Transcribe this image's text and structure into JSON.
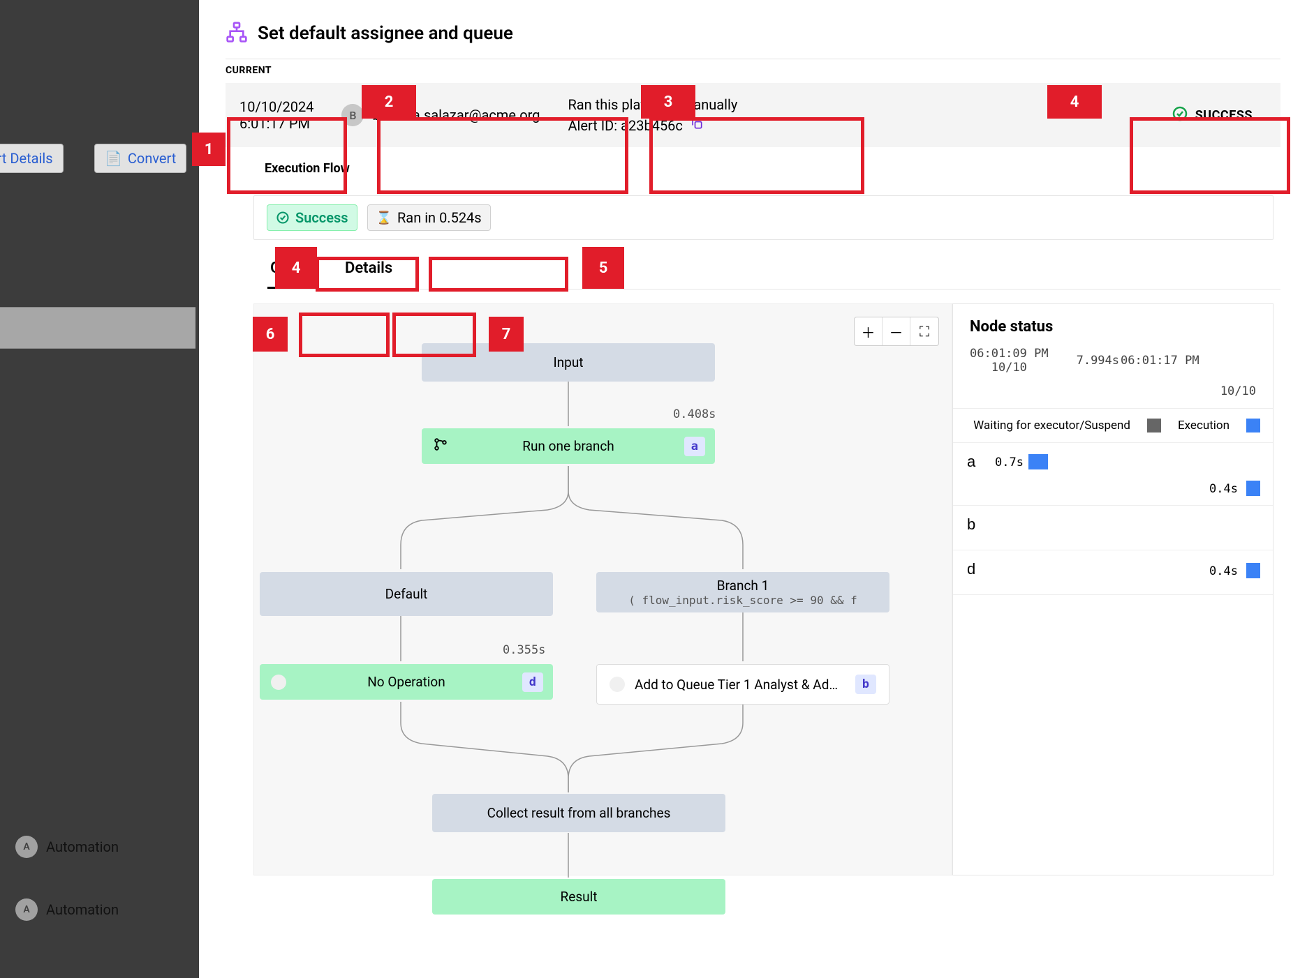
{
  "bg": {
    "btn1": "ert Details",
    "btn2": "Convert",
    "auto": "Automation"
  },
  "header": {
    "title": "Set default assignee and queue"
  },
  "current": {
    "label": "CURRENT",
    "date": "10/10/2024",
    "time": "6:01:17 PM",
    "user_initial": "B",
    "user_email": "barbara.salazar@acme.org",
    "action_line1": "Ran this playbook manually",
    "alert_label": "Alert ID: a23b456c",
    "status": "SUCCESS"
  },
  "exec": {
    "label": "Execution Flow",
    "success": "Success",
    "ran_in": "Ran in 0.524s"
  },
  "tabs": {
    "graph": "Graph",
    "details": "Details"
  },
  "graph": {
    "input": "Input",
    "run_one": "Run one branch",
    "run_one_badge": "a",
    "run_one_time": "0.408s",
    "default": "Default",
    "branch1": "Branch 1",
    "branch1_cond": "(  flow_input.risk_score >= 90  &&  f",
    "noop": "No Operation",
    "noop_badge": "d",
    "noop_time": "0.355s",
    "addq": "Add to Queue Tier 1 Analyst & Add A...",
    "addq_badge": "b",
    "collect": "Collect result from all branches",
    "result": "Result"
  },
  "node_status": {
    "title": "Node status",
    "start_time": "06:01:09 PM",
    "start_date": "10/10",
    "dur": "7.994s",
    "end_time": "06:01:17 PM",
    "end_date": "10/10",
    "legend_wait": "Waiting for executor/Suspend",
    "legend_exec": "Execution",
    "rows": {
      "a": {
        "letter": "a",
        "t1": "0.7s",
        "t2": "0.4s"
      },
      "b": {
        "letter": "b"
      },
      "d": {
        "letter": "d",
        "t2": "0.4s"
      }
    }
  },
  "callouts": {
    "c1": "1",
    "c2": "2",
    "c3": "3",
    "c4": "4",
    "c5": "5",
    "c6": "6",
    "c7": "7"
  }
}
